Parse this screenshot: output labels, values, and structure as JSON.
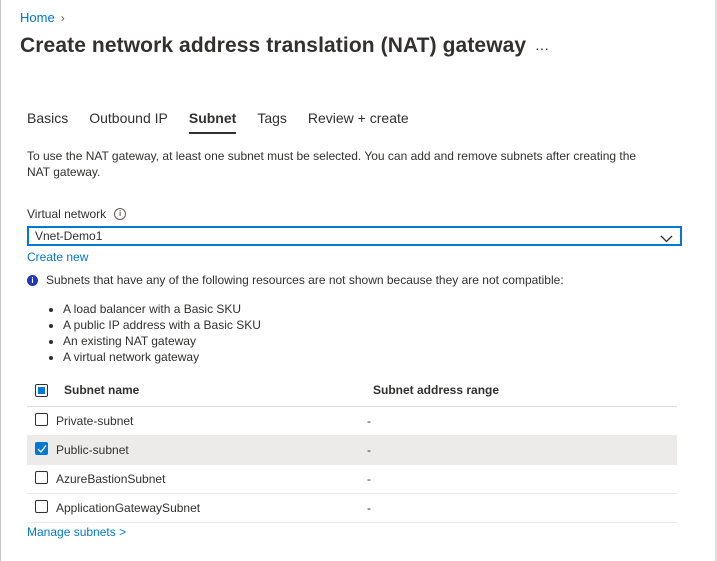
{
  "breadcrumb": {
    "home": "Home",
    "separator": "›"
  },
  "title": "Create network address translation (NAT) gateway",
  "more_label": "···",
  "tabs": [
    {
      "label": "Basics",
      "active": false
    },
    {
      "label": "Outbound IP",
      "active": false
    },
    {
      "label": "Subnet",
      "active": true
    },
    {
      "label": "Tags",
      "active": false
    },
    {
      "label": "Review + create",
      "active": false
    }
  ],
  "description": "To use the NAT gateway, at least one subnet must be selected. You can add and remove subnets after creating the NAT gateway.",
  "virtual_network": {
    "label": "Virtual network",
    "info_icon": "info-icon",
    "selected": "Vnet-Demo1",
    "create_new": "Create new"
  },
  "compat_notice": {
    "text": "Subnets that have any of the following resources are not shown because they are not compatible:",
    "items": [
      "A load balancer with a Basic SKU",
      "A public IP address with a Basic SKU",
      "An existing NAT gateway",
      "A virtual network gateway"
    ]
  },
  "subnet_table": {
    "columns": [
      "Subnet name",
      "Subnet address range"
    ],
    "rows": [
      {
        "name": "Private-subnet",
        "range": "-",
        "checked": false
      },
      {
        "name": "Public-subnet",
        "range": "-",
        "checked": true
      },
      {
        "name": "AzureBastionSubnet",
        "range": "-",
        "checked": false
      },
      {
        "name": "ApplicationGatewaySubnet",
        "range": "-",
        "checked": false
      }
    ]
  },
  "manage_subnets": "Manage subnets >",
  "colors": {
    "accent": "#0078d4",
    "selected_row": "#edebe9",
    "info_fill": "#2037b8"
  }
}
